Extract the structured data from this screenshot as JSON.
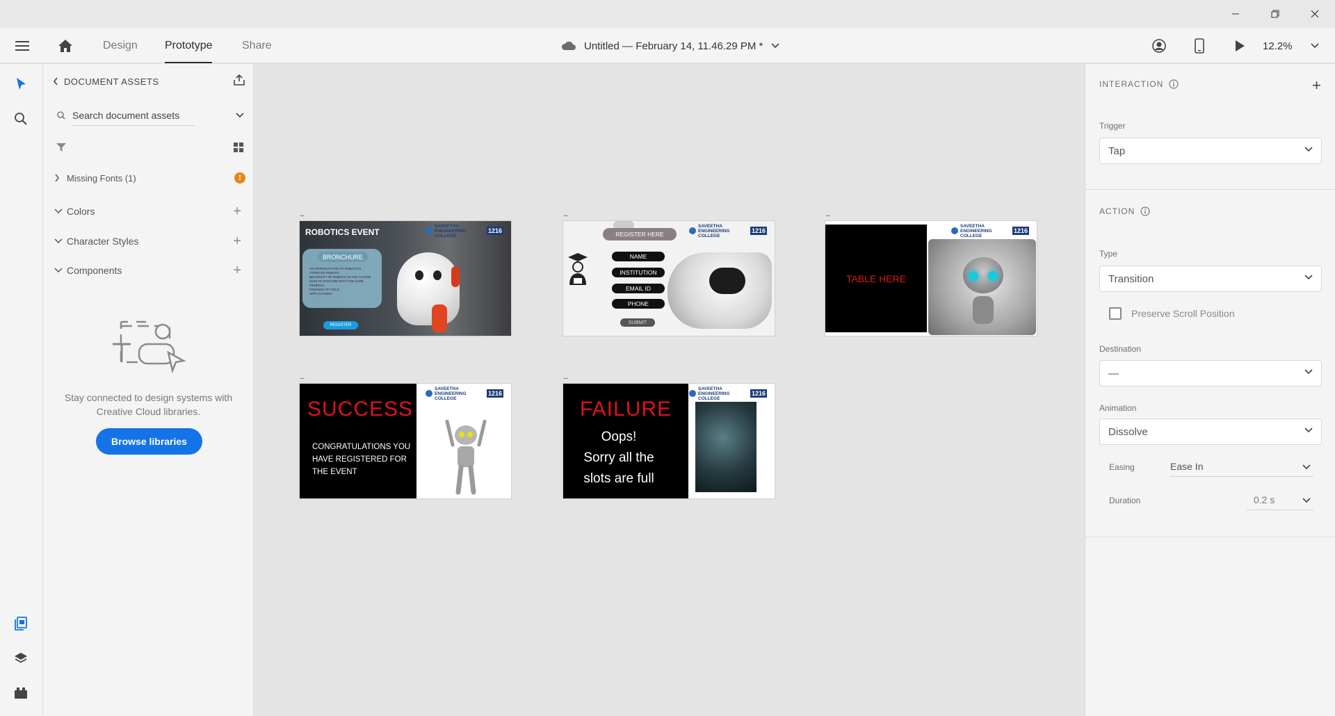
{
  "window": {
    "minimize_icon": "minimize-icon",
    "maximize_icon": "restore-icon",
    "close_icon": "close-icon"
  },
  "toolbar": {
    "tabs": [
      {
        "label": "Design"
      },
      {
        "label": "Prototype"
      },
      {
        "label": "Share"
      }
    ],
    "document_title": "Untitled — February 14, 11.46.29 PM *",
    "zoom": "12.2%"
  },
  "assets": {
    "header": "DOCUMENT ASSETS",
    "search_placeholder": "Search document assets",
    "missing_fonts": "Missing Fonts (1)",
    "warning_badge": "!",
    "sections": [
      {
        "label": "Colors"
      },
      {
        "label": "Character Styles"
      },
      {
        "label": "Components"
      }
    ],
    "empty_text": "Stay connected to design systems with Creative Cloud libraries.",
    "browse_button": "Browse libraries"
  },
  "artboards": {
    "dots": "...",
    "logo_name": "SAVEETHA ENGINEERING COLLEGE",
    "logo_code": "1216",
    "ab1": {
      "title": "ROBOTICS EVENT",
      "card_title": "BRONCHURE",
      "card_lines": [
        "AN INTRODUCTION TO ROBOTICS",
        "TYPES OF ROBOTS",
        "NECESSITY OF ROBOTS IN THE FUTURE",
        "HOW TO EXPLORE WITH THE SAME",
        "GENERAL",
        "FINDINGS OF FIELD",
        "APPLICATIONS"
      ],
      "button": "REGISTER"
    },
    "ab2": {
      "header": "REGISTER HERE",
      "fields": [
        "NAME",
        "INSTITUTION",
        "EMAIL ID",
        "PHONE"
      ],
      "submit": "SUBMIT"
    },
    "ab3": {
      "text": "TABLE HERE"
    },
    "ab4": {
      "title": "SUCCESS",
      "message": "CONGRATULATIONS YOU HAVE REGISTERED FOR THE EVENT"
    },
    "ab5": {
      "title": "FAILURE",
      "message_line1": "Oops!",
      "message_line2": "Sorry all the",
      "message_line3": "slots are full"
    }
  },
  "inspector": {
    "interaction_header": "INTERACTION",
    "trigger_label": "Trigger",
    "trigger_value": "Tap",
    "action_header": "ACTION",
    "type_label": "Type",
    "type_value": "Transition",
    "preserve_scroll": "Preserve Scroll Position",
    "preserve_scroll_checked": false,
    "destination_label": "Destination",
    "destination_value": "—",
    "animation_label": "Animation",
    "animation_value": "Dissolve",
    "easing_label": "Easing",
    "easing_value": "Ease In",
    "duration_label": "Duration",
    "duration_value": "0.2 s"
  },
  "colors": {
    "accent": "#1473e6",
    "warning": "#e68619",
    "danger_text": "#d7191c"
  }
}
